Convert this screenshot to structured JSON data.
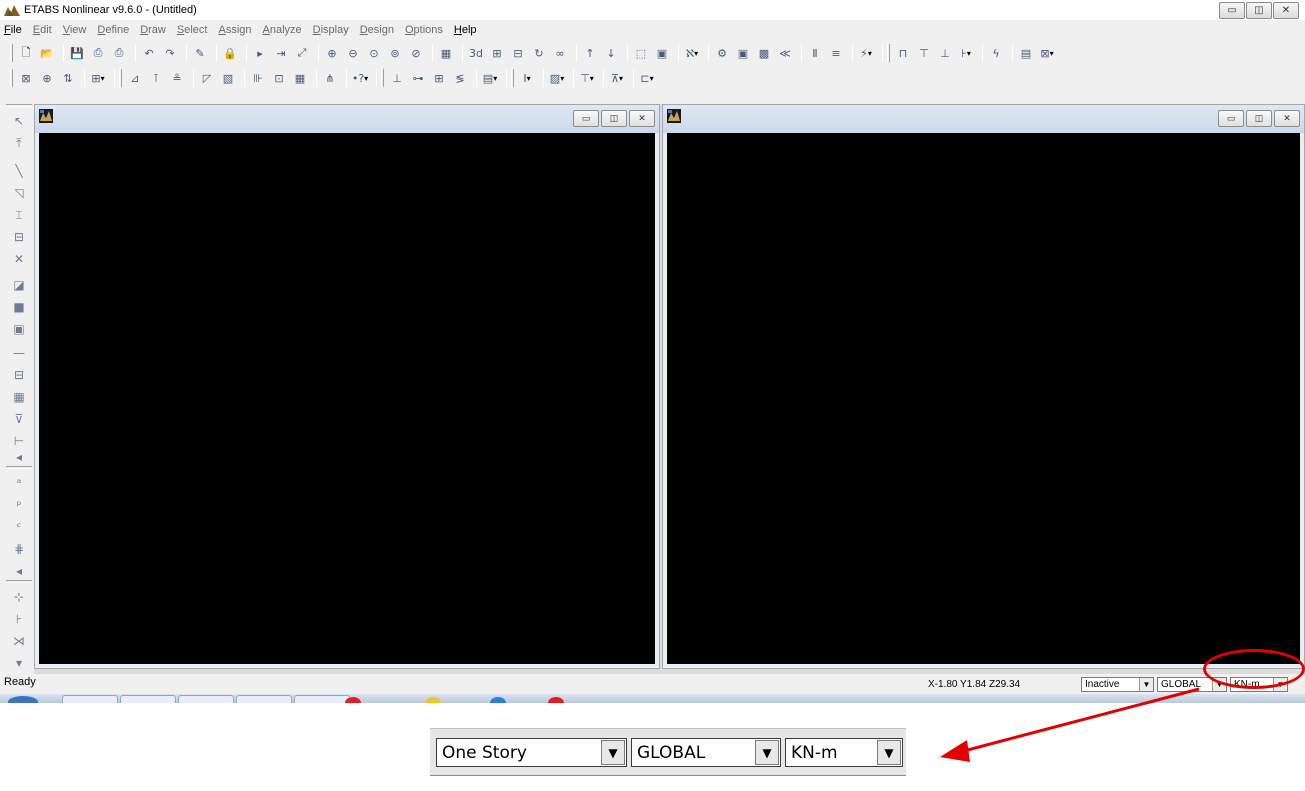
{
  "window": {
    "title": "ETABS Nonlinear v9.6.0 - (Untitled)",
    "controls": [
      "minimize-icon",
      "maximize-icon",
      "close-icon"
    ]
  },
  "menu": [
    {
      "label": "File",
      "enabled": true
    },
    {
      "label": "Edit",
      "enabled": false
    },
    {
      "label": "View",
      "enabled": false
    },
    {
      "label": "Define",
      "enabled": false
    },
    {
      "label": "Draw",
      "enabled": false
    },
    {
      "label": "Select",
      "enabled": false
    },
    {
      "label": "Assign",
      "enabled": false
    },
    {
      "label": "Analyze",
      "enabled": false
    },
    {
      "label": "Display",
      "enabled": false
    },
    {
      "label": "Design",
      "enabled": false
    },
    {
      "label": "Options",
      "enabled": false
    },
    {
      "label": "Help",
      "enabled": true
    }
  ],
  "toolbar1": {
    "text_buttons": {
      "view3d": "3d"
    }
  },
  "status": {
    "text": "Ready",
    "coords": "X-1.80  Y1.84  Z29.34",
    "story_mode": "Inactive",
    "coord_system": "GLOBAL",
    "units": "KN-m"
  },
  "zoom_callout": {
    "story_mode": "One Story",
    "coord_system": "GLOBAL",
    "units": "KN-m",
    "annotation_color": "#e30000"
  },
  "colors": {
    "canvas": "#000000",
    "chrome": "#f0f0f0",
    "child_title": "#dfe8f3"
  }
}
